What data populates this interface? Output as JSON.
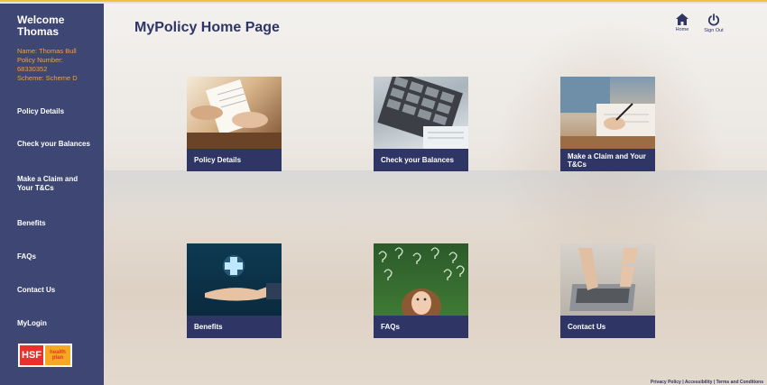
{
  "sidebar": {
    "welcome": "Welcome Thomas",
    "name": "Name: Thomas Bull",
    "policy_number": "Policy Number: 68330352",
    "scheme": "Scheme: Scheme D",
    "items": [
      {
        "label": "Policy Details"
      },
      {
        "label": "Check your Balances"
      },
      {
        "label": "Make a Claim and Your T&Cs"
      },
      {
        "label": "Benefits"
      },
      {
        "label": "FAQs"
      },
      {
        "label": "Contact Us"
      },
      {
        "label": "MyLogin"
      }
    ],
    "logo": {
      "left": "HSF",
      "right_top": "health",
      "right_bottom": "plan"
    }
  },
  "header": {
    "title": "MyPolicy Home Page",
    "home_label": "Home",
    "signout_label": "Sign Out"
  },
  "tiles": [
    {
      "label": "Policy Details"
    },
    {
      "label": "Check your Balances"
    },
    {
      "label": "Make a Claim and Your T&Cs"
    },
    {
      "label": "Benefits"
    },
    {
      "label": "FAQs"
    },
    {
      "label": "Contact Us"
    }
  ],
  "footer": {
    "privacy": "Privacy Policy",
    "sep1": " | ",
    "accessibility": "Accessibility",
    "sep2": " | ",
    "terms": "Terms and Conditions"
  },
  "colors": {
    "sidebar": "#3e4673",
    "accent": "#f5a03a",
    "tile_caption": "#2f3565",
    "top_border": "#f0c040"
  }
}
